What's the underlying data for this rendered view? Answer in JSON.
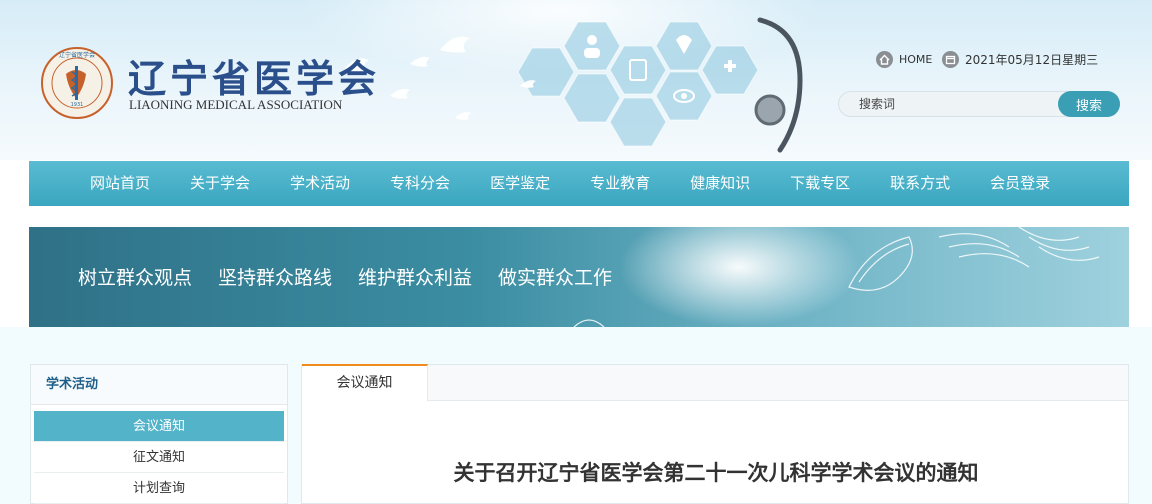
{
  "header": {
    "logo_cn": "辽宁省医学会",
    "logo_en": "LIAONING MEDICAL ASSOCIATION",
    "seal_text": "辽宁省医学会",
    "seal_year": "1931",
    "home_label": "HOME",
    "date_text": "2021年05月12日星期三",
    "search_placeholder": "搜索词",
    "search_button": "搜索"
  },
  "nav": {
    "items": [
      "网站首页",
      "关于学会",
      "学术活动",
      "专科分会",
      "医学鉴定",
      "专业教育",
      "健康知识",
      "下载专区",
      "联系方式",
      "会员登录"
    ]
  },
  "banner": {
    "slogans": [
      "树立群众观点",
      "坚持群众路线",
      "维护群众利益",
      "做实群众工作"
    ]
  },
  "sidebar": {
    "title": "学术活动",
    "items": [
      "会议通知",
      "征文通知",
      "计划查询"
    ]
  },
  "main": {
    "tab_label": "会议通知",
    "article_title": "关于召开辽宁省医学会第二十一次儿科学学术会议的通知"
  },
  "colors": {
    "nav_bg": "#3aa6bf",
    "brand_blue": "#2a4f8a",
    "accent_orange": "#f08c1e",
    "sidebar_active": "#53b3c9",
    "search_button": "#3a9fb4"
  }
}
